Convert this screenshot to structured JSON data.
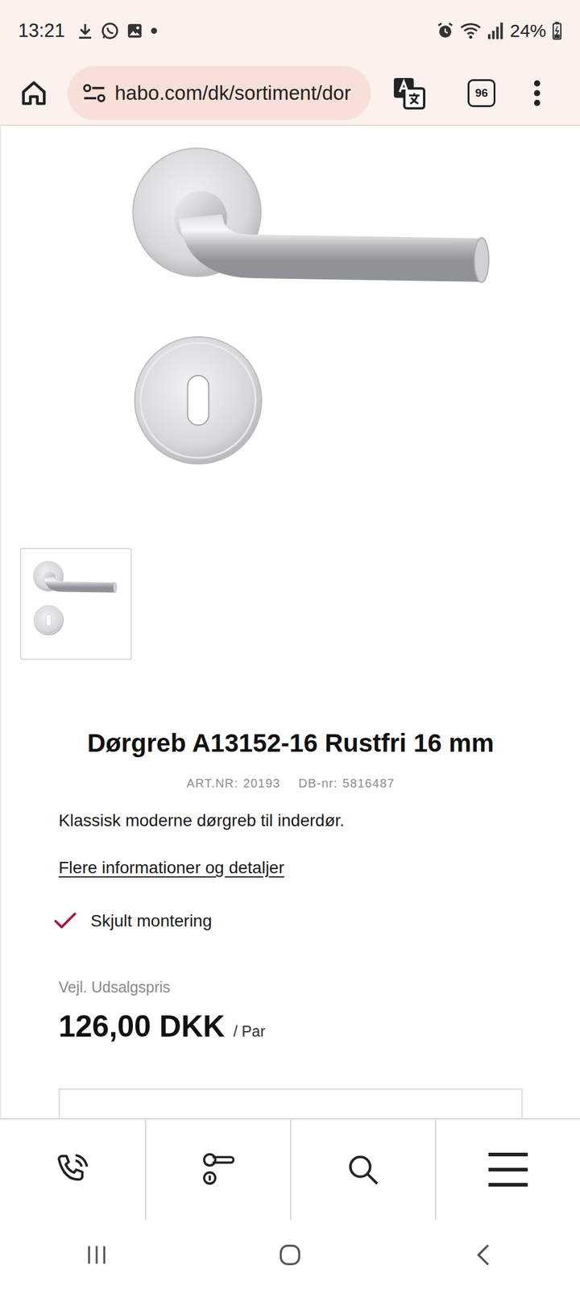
{
  "status_bar": {
    "time": "13:21",
    "battery": "24%"
  },
  "browser": {
    "url": "habo.com/dk/sortiment/dor",
    "tab_count": "96"
  },
  "gallery": {
    "thumbnails": [
      {
        "selected": true
      }
    ]
  },
  "product": {
    "title": "Dørgreb A13152-16 Rustfri 16 mm",
    "art_label": "ART.NR:",
    "art_nr": "20193",
    "db_label": "DB-nr:",
    "db_nr": "5816487",
    "description": "Klassisk moderne dørgreb til inderdør.",
    "details_link": "Flere informationer og detaljer",
    "features": [
      {
        "label": "Skjult montering",
        "checked": true
      }
    ],
    "price_label": "Vejl. Udsalgspris",
    "price": "126,00 DKK",
    "unit": "/ Par"
  }
}
